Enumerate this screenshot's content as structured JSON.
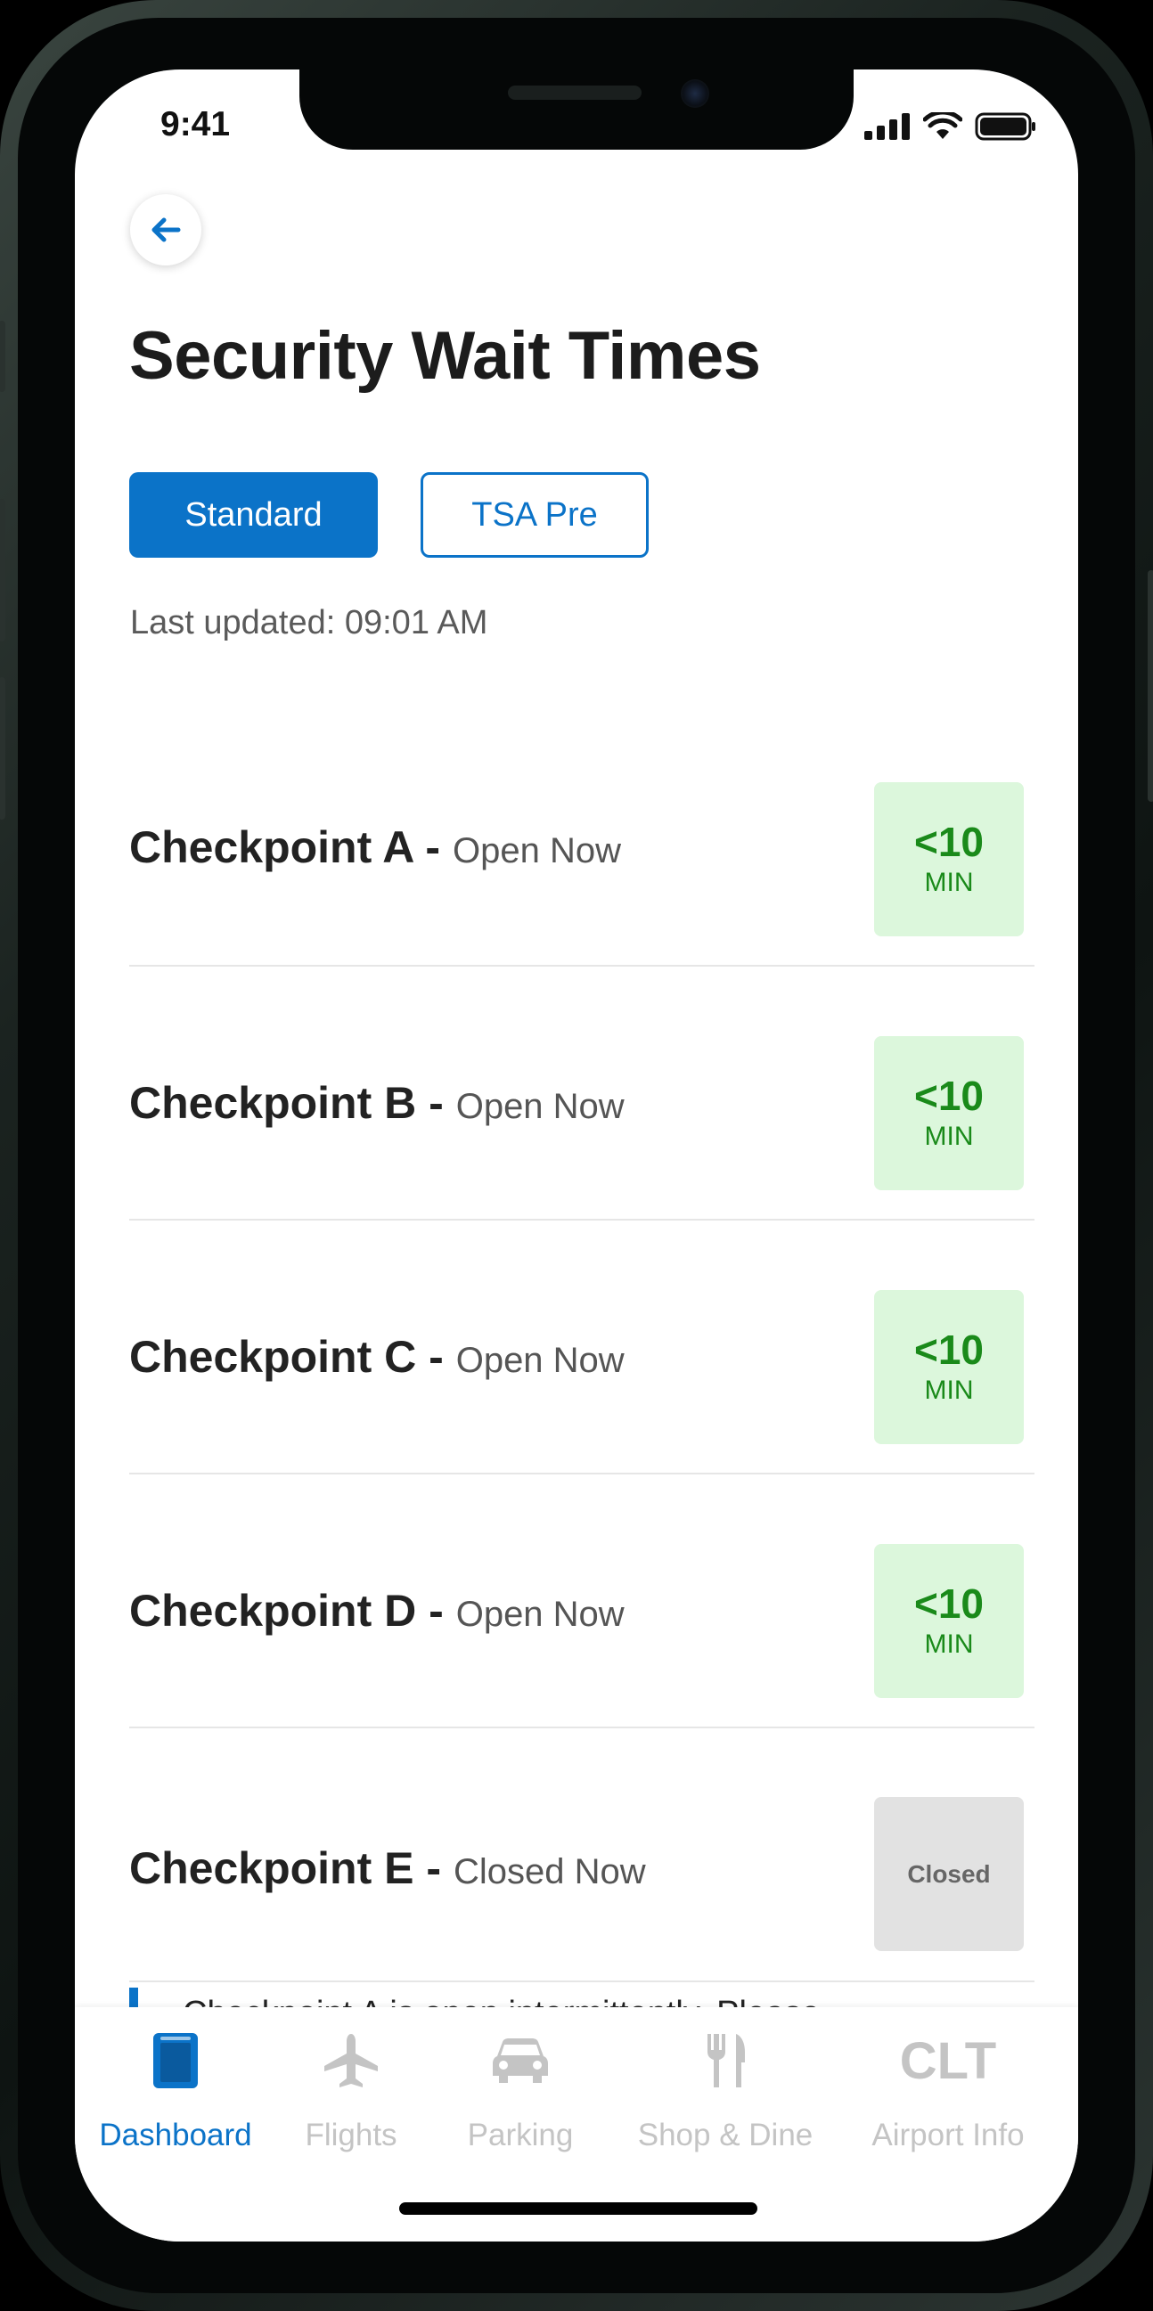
{
  "status_bar": {
    "time": "9:41"
  },
  "header": {
    "title": "Security Wait Times"
  },
  "tabs": [
    {
      "label": "Standard",
      "active": true
    },
    {
      "label": "TSA Pre",
      "active": false
    }
  ],
  "last_updated": "Last updated: 09:01 AM",
  "checkpoints": [
    {
      "name": "Checkpoint A -",
      "status": "Open Now",
      "wait": "<10",
      "unit": "MIN"
    },
    {
      "name": "Checkpoint B -",
      "status": "Open Now",
      "wait": "<10",
      "unit": "MIN"
    },
    {
      "name": "Checkpoint C -",
      "status": "Open Now",
      "wait": "<10",
      "unit": "MIN"
    },
    {
      "name": "Checkpoint D -",
      "status": "Open Now",
      "wait": "<10",
      "unit": "MIN"
    },
    {
      "name": "Checkpoint E -",
      "status": "Closed Now",
      "wait": "Closed"
    }
  ],
  "notice": {
    "text": "Checkpoint A is open intermittently. Please"
  },
  "tab_bar": [
    {
      "label": "Dashboard",
      "icon": "dashboard-icon",
      "active": true
    },
    {
      "label": "Flights",
      "icon": "airplane-icon",
      "active": false
    },
    {
      "label": "Parking",
      "icon": "car-icon",
      "active": false
    },
    {
      "label": "Shop & Dine",
      "icon": "fork-knife-icon",
      "active": false
    },
    {
      "label": "Airport Info",
      "icon": "clt-logo-icon",
      "icon_text": "CLT",
      "active": false
    }
  ],
  "colors": {
    "accent": "#0b73c8",
    "open_bg": "#dcf7dc",
    "open_text": "#1a8a1a",
    "closed_bg": "#e2e2e2"
  }
}
